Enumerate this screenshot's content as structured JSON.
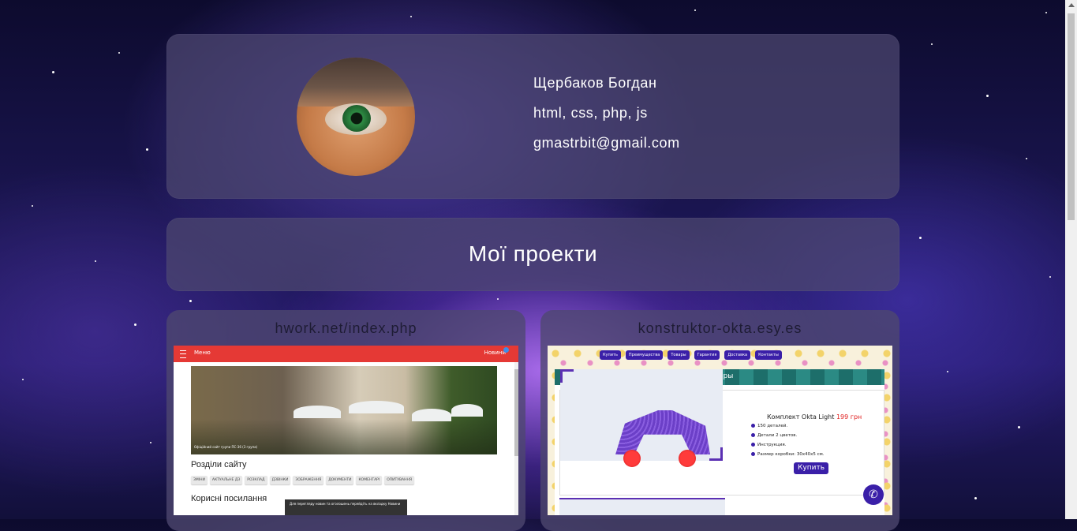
{
  "profile": {
    "name": "Щербаков Богдан",
    "skills": "html, css, php, js",
    "email": "gmastrbit@gmail.com"
  },
  "projects": {
    "title": "Мої проекти",
    "cards": [
      {
        "title": "hwork.net/index.php",
        "preview": {
          "menu_label": "Меню",
          "news_label": "Новини",
          "photo_caption": "Офіційний сайт групи ПС-36 (3 група)",
          "section1_title": "Розділи сайту",
          "chips": [
            "ЗМІНИ",
            "АКТУАЛЬНЕ ДЗ",
            "РОЗКЛАД",
            "ДЗВІНКИ",
            "ЗОБРАЖЕННЯ",
            "ДОКУМЕНТИ",
            "КОМЕНТАРІ",
            "ОПИТУВАННЯ"
          ],
          "section2_title": "Корисні посилання",
          "toast": "Для перегляду новин та оголошень перейдіть на вкладку Новини"
        }
      },
      {
        "title": "konstruktor-okta.esy.es",
        "preview": {
          "nav": [
            "Купить",
            "Преимущества",
            "Товары",
            "Гарантия",
            "Доставка",
            "Контакты"
          ],
          "section_title": "Товары",
          "product_name": "Комплект Okta Light",
          "product_price": "199 грн",
          "features": [
            "150 деталей.",
            "Детали 2 цветов.",
            "Инструкция.",
            "Размер коробки: 30x40x5 см."
          ],
          "buy_label": "Купить"
        }
      }
    ]
  },
  "icons": {
    "phone": "phone-icon",
    "menu": "menu-icon"
  },
  "colors": {
    "hwork_bar": "#e53935",
    "okta_accent": "#3a1fa8"
  }
}
